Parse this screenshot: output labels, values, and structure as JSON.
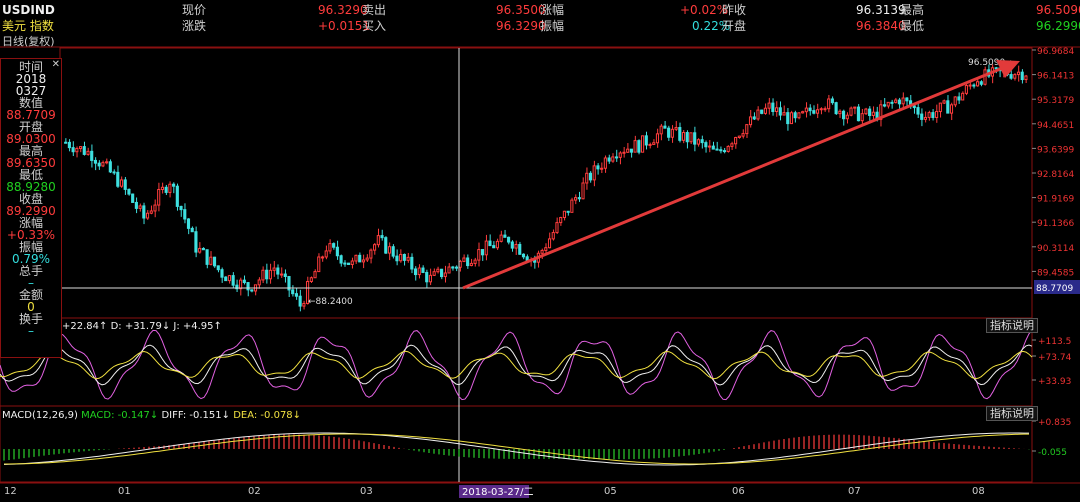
{
  "header": {
    "symbol": "USDIND",
    "name": "美元 指数",
    "period": "日线(复权)",
    "row1": [
      {
        "label": "现价",
        "value": "96.3290"
      },
      {
        "label": "卖出",
        "value": "96.3500"
      },
      {
        "label": "涨幅",
        "value": "+0.02%"
      },
      {
        "label": "昨收",
        "value": "96.3139"
      },
      {
        "label": "最高",
        "value": "96.5090"
      }
    ],
    "row2": [
      {
        "label": "涨跌",
        "value": "+0.0151"
      },
      {
        "label": "买入",
        "value": "96.3290"
      },
      {
        "label": "振幅",
        "value": "0.22%"
      },
      {
        "label": "开盘",
        "value": "96.3840"
      },
      {
        "label": "最低",
        "value": "96.2990"
      }
    ]
  },
  "info_panel": {
    "time_label": "时间",
    "time_year": "2018",
    "time_md": "0327",
    "value_label": "数值",
    "value": "88.7709",
    "open_label": "开盘",
    "open": "89.0300",
    "high_label": "最高",
    "high": "89.6350",
    "low_label": "最低",
    "low": "88.9280",
    "close_label": "收盘",
    "close": "89.2990",
    "change_label": "涨幅",
    "change": "+0.33%",
    "amp_label": "振幅",
    "amp": "0.79%",
    "vol_label": "总手",
    "vol": "–",
    "amount_label": "金额",
    "amount": "0",
    "turnover_label": "换手",
    "turnover": "–"
  },
  "main_chart": {
    "y_ticks": [
      "96.9684",
      "96.1413",
      "95.3179",
      "94.4651",
      "93.6399",
      "92.8164",
      "91.9169",
      "91.1366",
      "90.3114",
      "89.4585"
    ],
    "crosshair_value": "88.7709",
    "low_annotation": "88.2400",
    "high_annotation": "96.5090"
  },
  "kdj": {
    "title": "+22.84↑ D: +31.79↓ J: +4.95↑",
    "y_ticks": [
      "+113.5",
      "+73.74",
      "+33.93"
    ],
    "help": "指标说明"
  },
  "macd": {
    "title": "MACD(12,26,9)",
    "macd_val": "MACD: -0.147↓",
    "diff_val": "DIFF: -0.151↓",
    "dea_val": "DEA: -0.078↓",
    "y_ticks": [
      "+0.835",
      "-0.055"
    ],
    "help": "指标说明"
  },
  "x_axis": {
    "labels": [
      "12",
      "01",
      "02",
      "03",
      "05",
      "06",
      "07",
      "08"
    ],
    "cursor_date": "2018-03-27/二"
  },
  "colors": {
    "up": "#ff3c3c",
    "down": "#3fe0e0",
    "arrow": "#e23a3a",
    "grid": "#8a1010"
  },
  "chart_data": {
    "type": "candlestick",
    "series_points": [
      {
        "name": "close_approx",
        "values": [
          93.9,
          93.5,
          92.6,
          91.3,
          92.6,
          90.3,
          89.4,
          88.9,
          89.6,
          88.3,
          90.3,
          89.7,
          90.5,
          89.8,
          89.2,
          89.7,
          90.2,
          90.6,
          89.8,
          91.2,
          92.6,
          93.6,
          93.8,
          94.3,
          94.0,
          93.5,
          94.4,
          95.1,
          94.6,
          95.3,
          94.9,
          94.8,
          95.4,
          94.8,
          95.2,
          96.1,
          96.3
        ]
      }
    ]
  }
}
